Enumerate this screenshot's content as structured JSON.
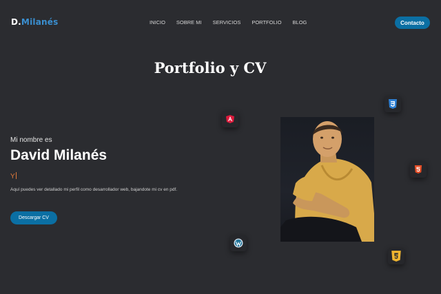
{
  "header": {
    "logo_initial": "D.",
    "logo_rest": "Milanés",
    "nav": [
      "INICIO",
      "SOBRE MI",
      "SERVICIOS",
      "PORTFOLIO",
      "BLOG"
    ],
    "contact_label": "Contacto"
  },
  "hero": {
    "title": "Portfolio y CV",
    "greeting": "Mi nombre es",
    "name": "David Milanés",
    "typed_text": "Y",
    "description": "Aquí puedes ver detallado mi perfil como desarrollador web, bajandote mi cv en pdf.",
    "cv_button": "Descargar CV"
  },
  "tech_icons": [
    "angular-icon",
    "css3-icon",
    "html5-icon",
    "wordpress-icon",
    "javascript-icon"
  ],
  "colors": {
    "background": "#2b2c30",
    "accent": "#0b6fa3",
    "logo_blue": "#3a8fd0",
    "typed_orange": "#e07a3a"
  }
}
